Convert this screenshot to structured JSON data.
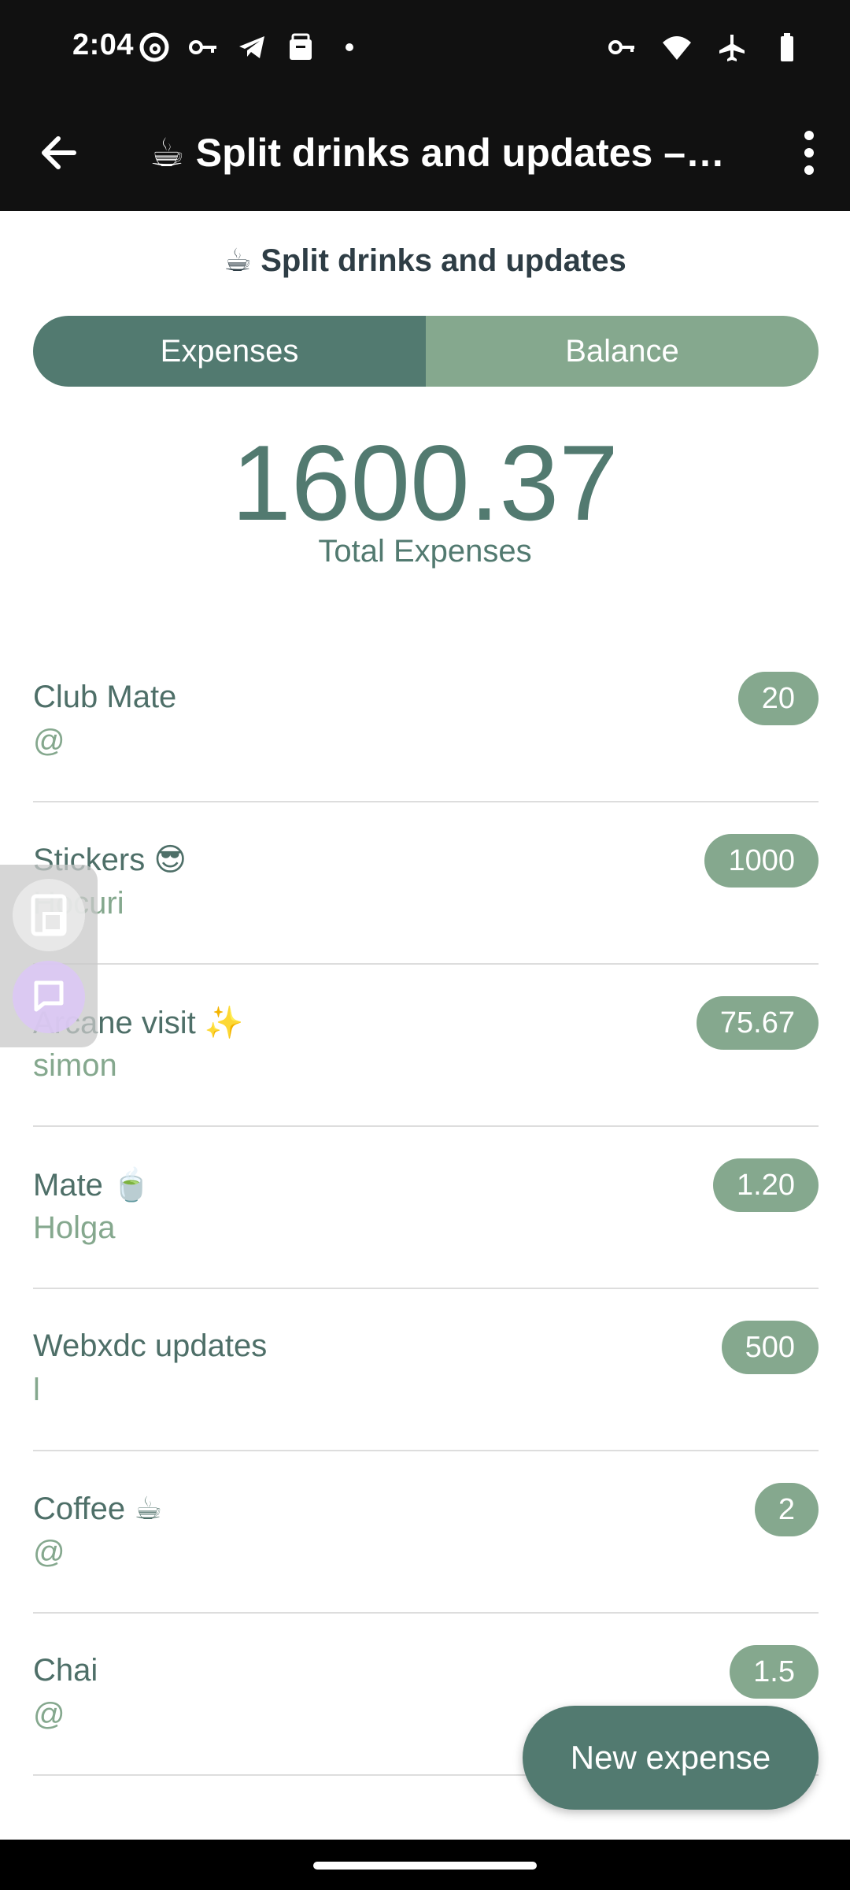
{
  "status_bar": {
    "time": "2:04",
    "left_icons": [
      "threads-icon",
      "key-icon",
      "telegram-icon",
      "bag-icon",
      "dot-icon"
    ],
    "right_icons": [
      "vpn-key-icon",
      "wifi-icon",
      "airplane-icon",
      "battery-icon"
    ]
  },
  "app_bar": {
    "title": "☕ Split drinks and updates –…"
  },
  "app": {
    "heading": "☕ Split drinks and updates",
    "tabs": [
      {
        "label": "Expenses",
        "active": true
      },
      {
        "label": "Balance",
        "active": false
      }
    ],
    "total": {
      "amount": "1600.37",
      "label": "Total Expenses"
    },
    "expenses": [
      {
        "title": "Club Mate",
        "payer": "@",
        "amount": "20"
      },
      {
        "title": "Stickers 😎",
        "payer": "Hocuri",
        "amount": "1000"
      },
      {
        "title": "Arcane visit ✨",
        "payer": "simon",
        "amount": "75.67"
      },
      {
        "title": "Mate 🍵",
        "payer": "Holga",
        "amount": "1.20"
      },
      {
        "title": "Webxdc updates",
        "payer": "l",
        "amount": "500"
      },
      {
        "title": "Coffee ☕",
        "payer": "@",
        "amount": "2"
      },
      {
        "title": "Chai",
        "payer": "@",
        "amount": "1.5"
      }
    ],
    "new_expense_button": "New expense"
  },
  "colors": {
    "primary": "#527a70",
    "secondary": "#85a88e",
    "bar": "#111111"
  }
}
